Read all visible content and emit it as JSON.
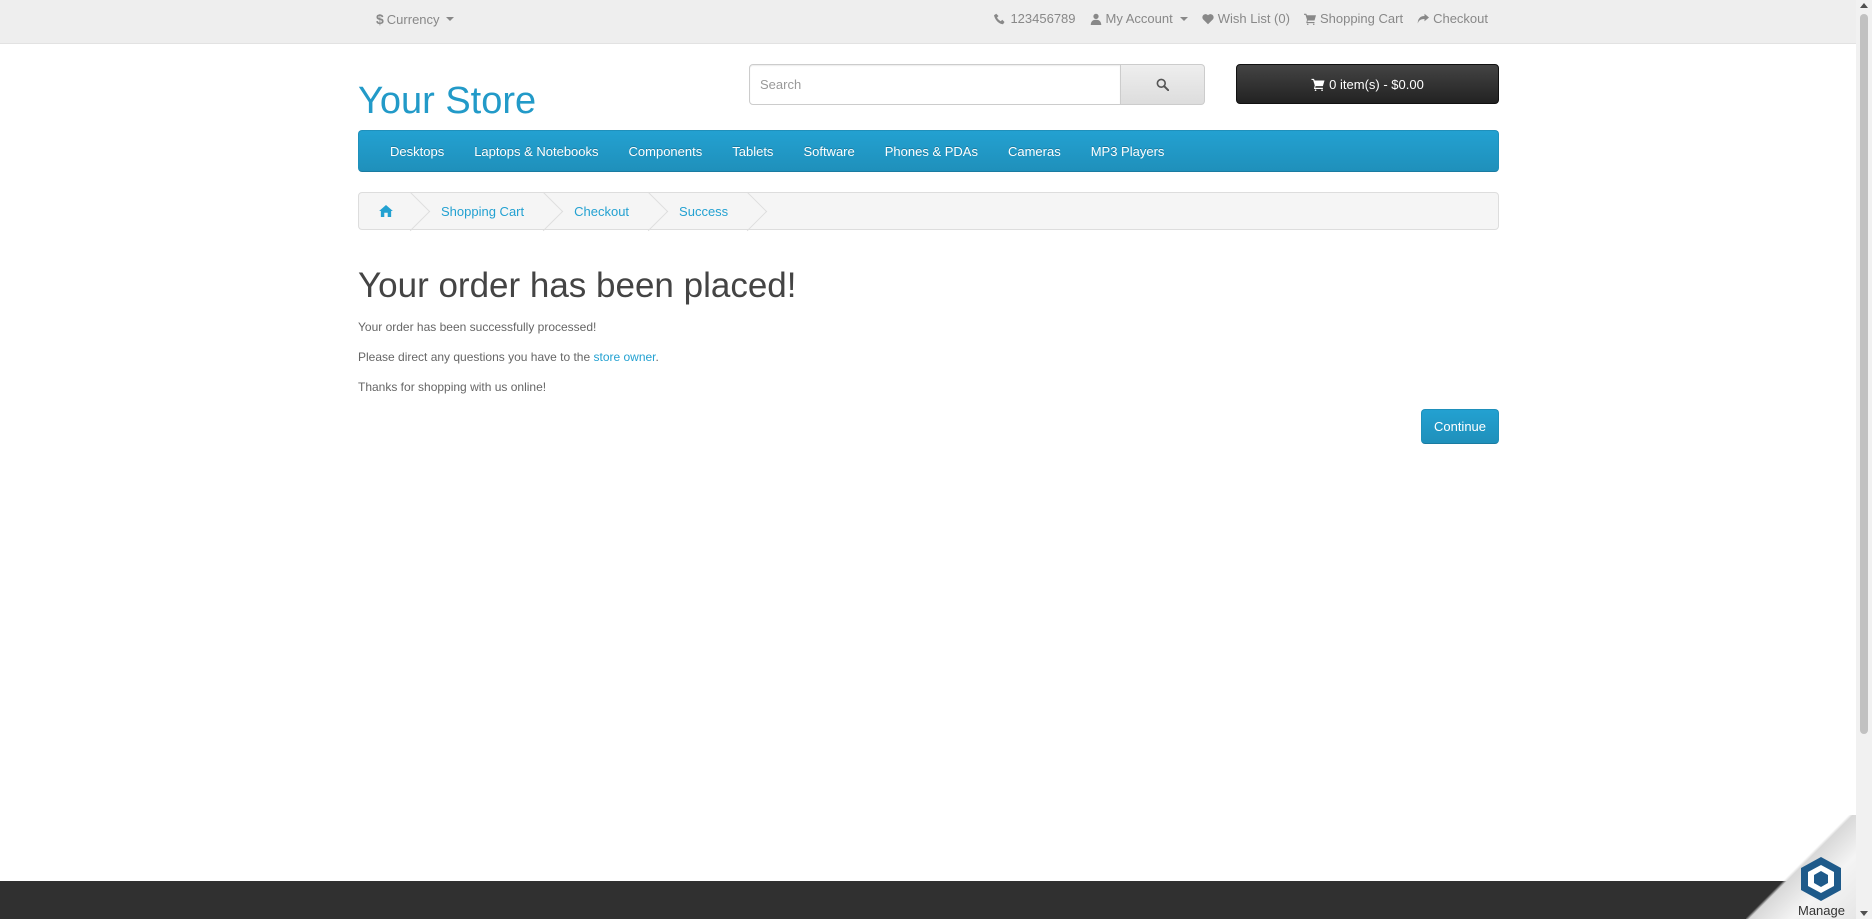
{
  "topbar": {
    "currency_symbol": "$",
    "currency_label": "Currency",
    "phone": "123456789",
    "my_account": "My Account",
    "wish_list": "Wish List (0)",
    "shopping_cart": "Shopping Cart",
    "checkout": "Checkout"
  },
  "header": {
    "logo": "Your Store",
    "search_placeholder": "Search",
    "cart_button": "0 item(s) - $0.00"
  },
  "menu": {
    "items": [
      "Desktops",
      "Laptops & Notebooks",
      "Components",
      "Tablets",
      "Software",
      "Phones & PDAs",
      "Cameras",
      "MP3 Players"
    ]
  },
  "breadcrumb": {
    "items": [
      "Shopping Cart",
      "Checkout",
      "Success"
    ]
  },
  "content": {
    "title": "Your order has been placed!",
    "line1": "Your order has been successfully processed!",
    "line2_prefix": "Please direct any questions you have to the ",
    "line2_link": "store owner",
    "line2_suffix": ".",
    "line3": "Thanks for shopping with us online!",
    "continue_label": "Continue"
  },
  "widget": {
    "manage_label": "Manage"
  },
  "colors": {
    "accent": "#23a1d1",
    "menu_bg": "#229ac8",
    "footer_bg": "#303030"
  }
}
